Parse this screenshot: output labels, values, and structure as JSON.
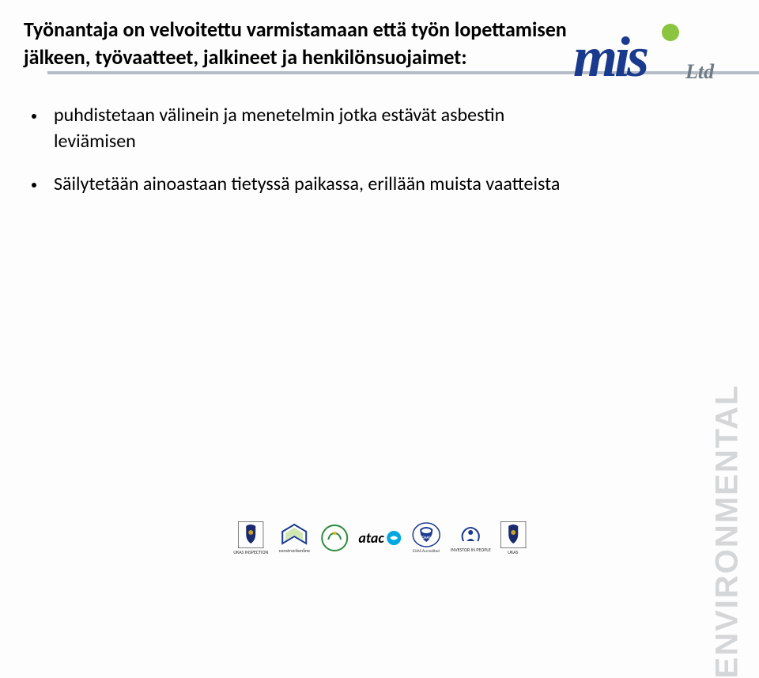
{
  "heading": "Työnantaja on velvoitettu varmistamaan että työn lopettamisen jälkeen, työvaatteet, jalkineet ja henkilönsuojaimet:",
  "bullets": [
    "puhdistetaan välinein ja menetelmin jotka estävät asbestin leviämisen",
    "Säilytetään ainoastaan tietyssä paikassa, erillään muista vaatteista"
  ],
  "logo": {
    "brand": "mis",
    "suffix": "Ltd"
  },
  "sidebar": "ENVIRONMENTAL",
  "footer": {
    "ukas_inspection": "UKAS INSPECTION",
    "constructionline": "constructionline",
    "atac": "atac",
    "chas": "CHAS",
    "investor": "INVESTOR IN PEOPLE",
    "ukas_testing": "UKAS"
  }
}
